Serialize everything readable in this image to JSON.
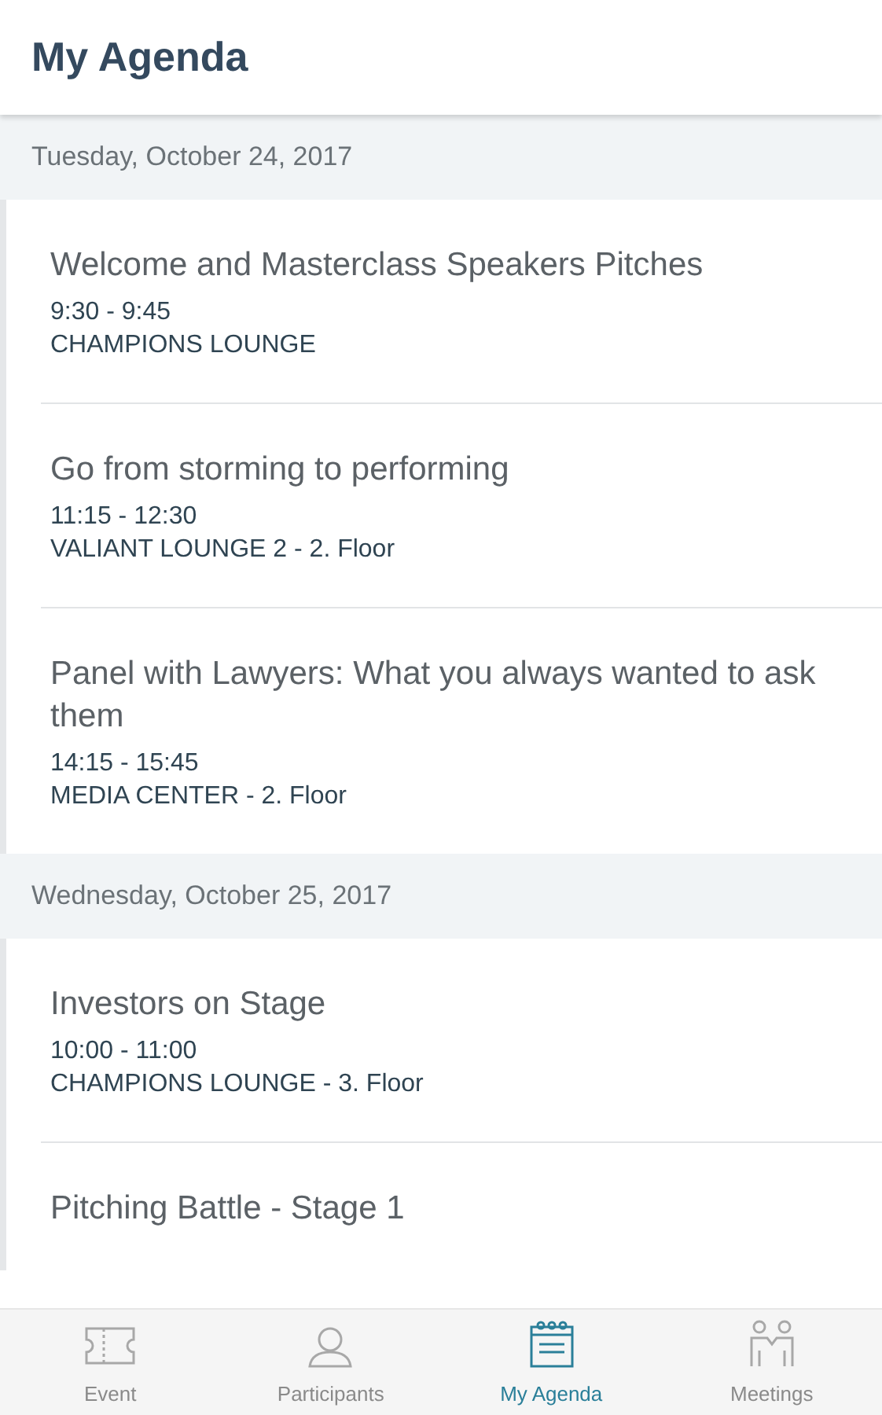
{
  "header": {
    "title": "My Agenda"
  },
  "days": [
    {
      "date": "Tuesday, October 24, 2017",
      "sessions": [
        {
          "title": "Welcome and Masterclass Speakers Pitches",
          "time": "9:30 - 9:45",
          "location": "CHAMPIONS LOUNGE"
        },
        {
          "title": "Go from storming to performing",
          "time": "11:15 - 12:30",
          "location": "VALIANT LOUNGE 2 - 2. Floor"
        },
        {
          "title": "Panel with Lawyers: What you always wanted to ask them",
          "time": "14:15 - 15:45",
          "location": "MEDIA CENTER - 2. Floor"
        }
      ]
    },
    {
      "date": "Wednesday, October 25, 2017",
      "sessions": [
        {
          "title": "Investors on Stage",
          "time": "10:00 - 11:00",
          "location": "CHAMPIONS LOUNGE - 3. Floor"
        },
        {
          "title": "Pitching Battle - Stage 1"
        }
      ]
    }
  ],
  "nav": [
    {
      "kind": "event",
      "label": "Event",
      "selected": false
    },
    {
      "kind": "participants",
      "label": "Participants",
      "selected": false
    },
    {
      "kind": "agenda",
      "label": "My Agenda",
      "selected": true
    },
    {
      "kind": "meetings",
      "label": "Meetings",
      "selected": false
    }
  ]
}
